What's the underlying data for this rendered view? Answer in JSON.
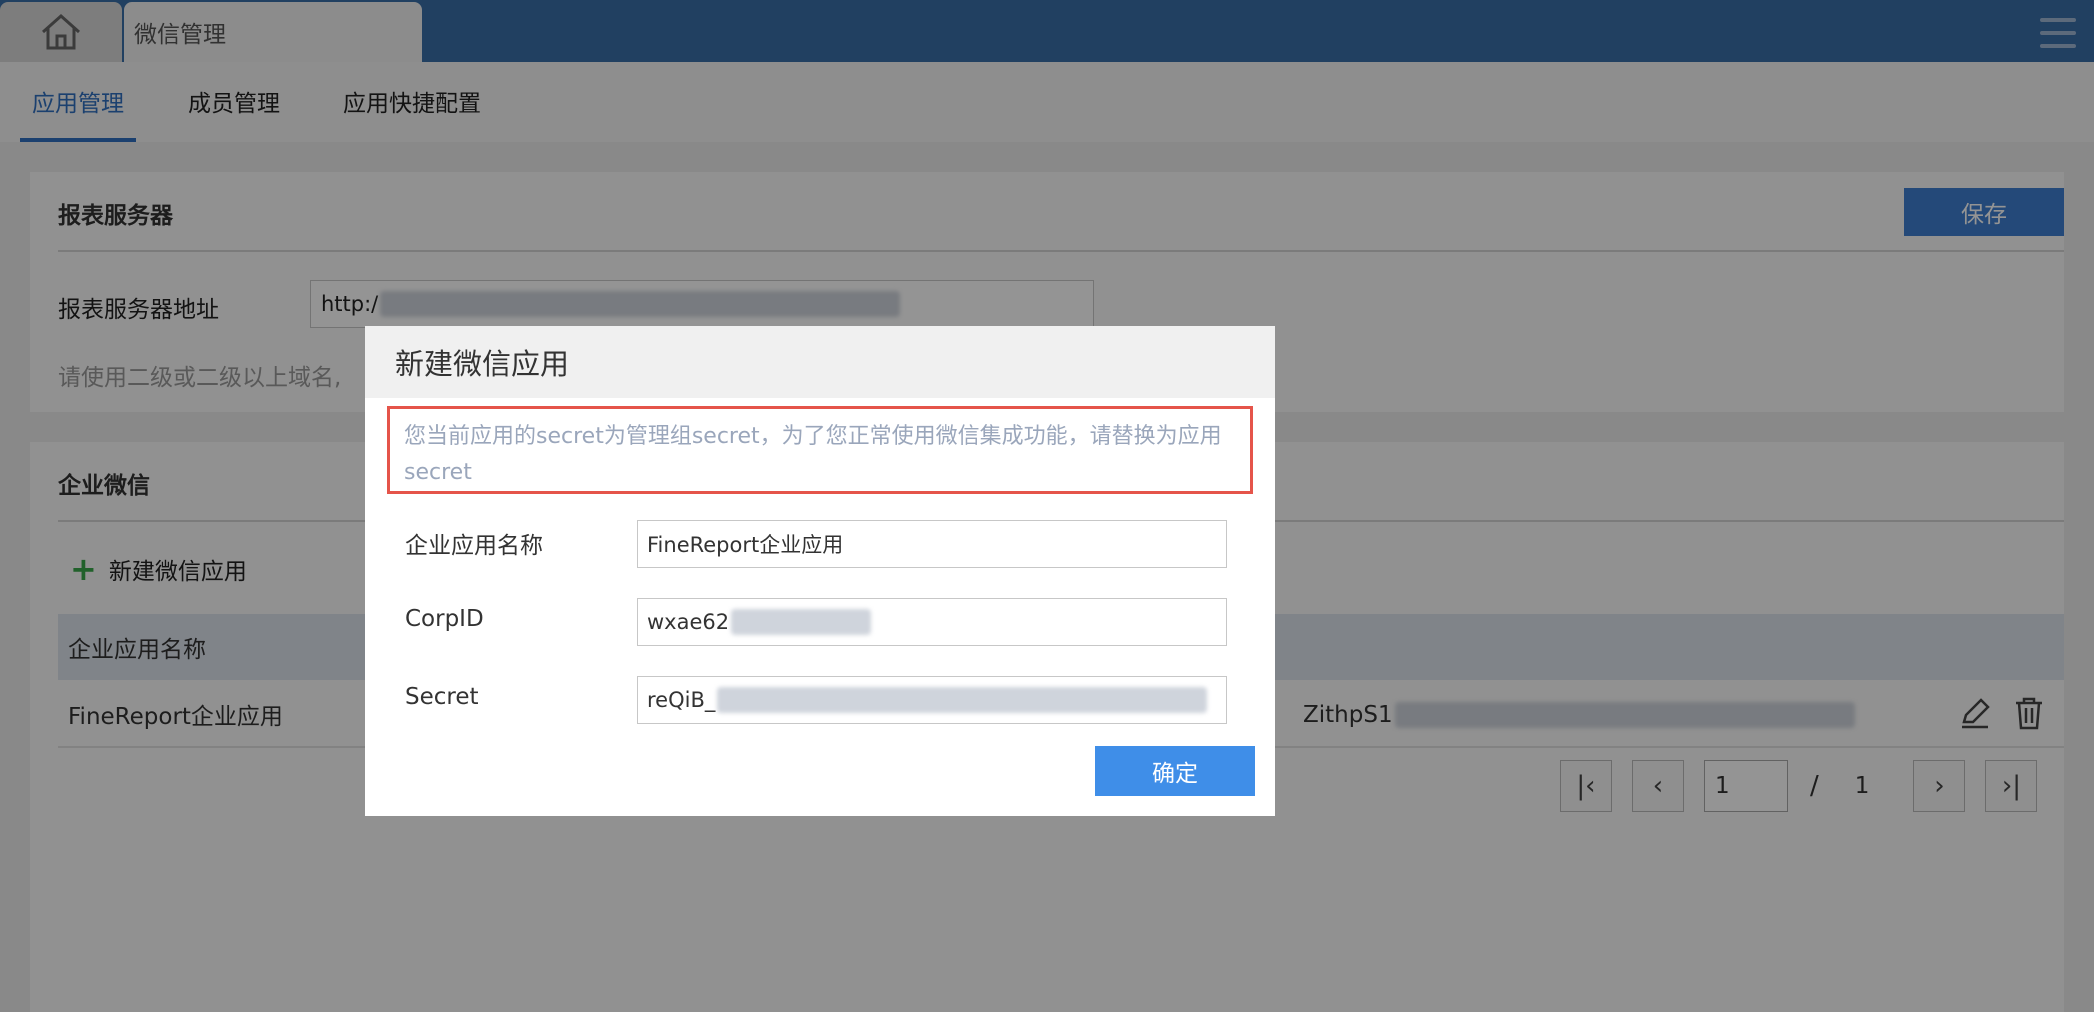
{
  "topbar": {
    "app_tab_label": "微信管理"
  },
  "subtabs": [
    "应用管理",
    "成员管理",
    "应用快捷配置"
  ],
  "report_server": {
    "title": "报表服务器",
    "save_label": "保存",
    "address_label": "报表服务器地址",
    "address_value": "http:/",
    "hint": "请使用二级或二级以上域名,"
  },
  "enterprise_wechat": {
    "title": "企业微信",
    "new_app_label": "新建微信应用",
    "table_header": "企业应用名称",
    "rows": [
      {
        "name": "FineReport企业应用",
        "secret": "ZithpS1"
      }
    ],
    "pager": {
      "current": "1",
      "separator": "/",
      "total": "1"
    }
  },
  "dialog": {
    "title": "新建微信应用",
    "warning": "您当前应用的secret为管理组secret，为了您正常使用微信集成功能，请替换为应用secret",
    "app_name_label": "企业应用名称",
    "app_name_value": "FineReport企业应用",
    "corpid_label": "CorpID",
    "corpid_value": "wxae62",
    "secret_label": "Secret",
    "secret_value": "reQiB_",
    "confirm_label": "确定"
  },
  "colors": {
    "accent": "#3f7fd0",
    "warning_border": "#e5544a",
    "topbar": "#3a6ea8",
    "confirm": "#3f8ee8"
  }
}
